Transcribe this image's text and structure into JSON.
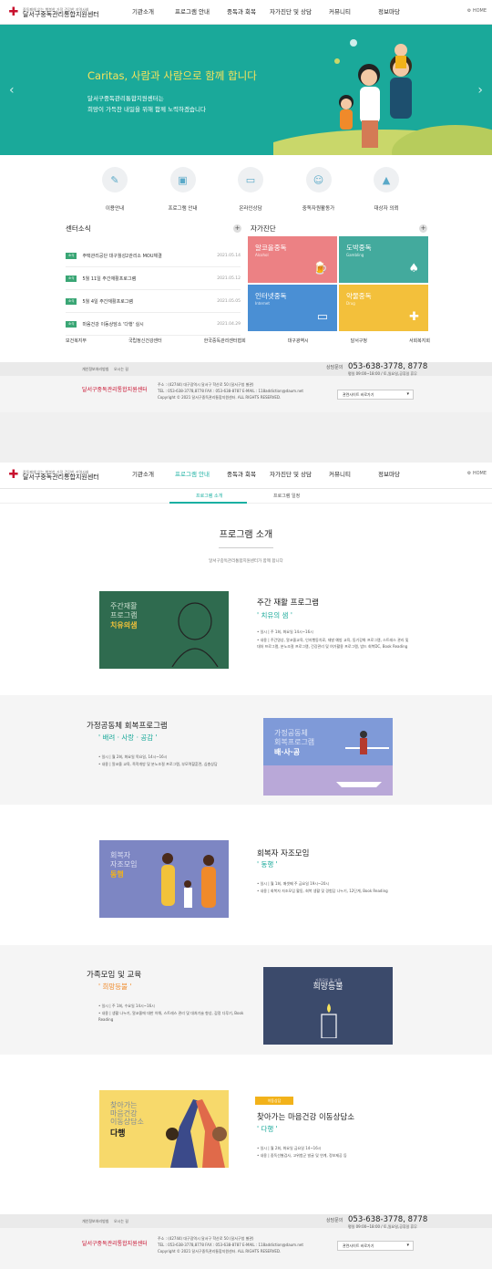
{
  "logo": {
    "name": "달서구중독관리통합지원센터",
    "tagline": "중독폐해 없는 행복한 가정 건강한 지역사회",
    "mark_caption": "Caritas"
  },
  "nav": [
    "기관소개",
    "프로그램 안내",
    "중독과 회복",
    "자가진단 및 상담",
    "커뮤니티",
    "정보마당"
  ],
  "home_label": "HOME",
  "hero": {
    "title": "Caritas, 사람과 사람으로 함께 합니다",
    "line1": "달서구중독관리통합지원센터는",
    "line2": "희망이 가득찬 내일을 위해 함께 노력하겠습니다"
  },
  "quick": [
    {
      "label": "이용안내",
      "icon": "document-pen-icon"
    },
    {
      "label": "프로그램 안내",
      "icon": "chat-icon"
    },
    {
      "label": "온라인상담",
      "icon": "monitor-icon"
    },
    {
      "label": "중독자원활동가",
      "icon": "user-icon"
    },
    {
      "label": "대상자 의뢰",
      "icon": "alarm-icon"
    }
  ],
  "news": {
    "title": "센터소식",
    "badge": "소식",
    "items": [
      {
        "text": "주택관리공단 대구월성2관리소 MOU체결",
        "date": "2021.05.14"
      },
      {
        "text": "5월 11일 주간재활프로그램",
        "date": "2021.05.12"
      },
      {
        "text": "5월 4일 주간재활프로그램",
        "date": "2021.05.05"
      },
      {
        "text": "마음건강 이동상담소 '다행' 실시",
        "date": "2021.04.29"
      }
    ]
  },
  "selfcheck": {
    "title": "자가진단",
    "tiles": [
      {
        "ko": "알코올중독",
        "en": "Alcohol",
        "color": "#ec8184"
      },
      {
        "ko": "도박중독",
        "en": "Gambling",
        "color": "#43aa9d"
      },
      {
        "ko": "인터넷중독",
        "en": "Internet",
        "color": "#4a8fd4"
      },
      {
        "ko": "약물중독",
        "en": "Drug",
        "color": "#f3c03b"
      }
    ]
  },
  "partners": [
    "보건복지부",
    "국립정신건강센터",
    "한국중독관리센터협회",
    "대구광역시",
    "달서구청",
    "서회복지회"
  ],
  "footer": {
    "links": [
      "개인정보처리방침",
      "오시는 길"
    ],
    "address": "주소 : (42744) 대구광역시 달서구 학산로 50 (달서구청 별관)",
    "contacts": "TEL : 053-638-3778,8778   FAX : 053-638-8787   E-MAIL : 118addiction@daum.net",
    "copyright": "Copyright © 2021 달서구중독관리통합지원센터. ALL RIGHTS RESERVED.",
    "tel_label": "상담문의",
    "tel": "053-638-3778, 8778",
    "hours": "평일 09:00~18:00 / 토,일요일,공휴일 휴무",
    "related": "관련사이트 바로가기"
  },
  "program_page": {
    "subtabs": [
      "프로그램 소개",
      "프로그램 일정"
    ],
    "title": "프로그램 소개",
    "subtitle": "달서구중독관리통합지원센터가 함께 합니다",
    "programs": [
      {
        "title": "주간 재활 프로그램",
        "slogan": "' 치유의 샘 '",
        "img_text": [
          "주간재활",
          "프로그램"
        ],
        "img_slogan": "치유의샘",
        "details": [
          "• 일시 | 주 1회, 화요일 14시~16시",
          "• 내용 | 주간명상, 알코올교육, 인지행동치료, 재발 예방 교육, 동기강화 프로그램, 스트레스 관리 및 대처 프로그램, 분노조절 프로그램, 건강관리 및 여가활용 프로그램, 밥드 회복DC, Book Reading"
        ]
      },
      {
        "title": "가정공동체 회복프로그램",
        "slogan": "' 배려 · 사랑 · 공감 '",
        "img_text": [
          "가정공동체",
          "회복프로그램"
        ],
        "img_slogan": "배·사·공",
        "details": [
          "• 일시 | 월 2회, 화요일 목요일, 14시~16시",
          "• 내용 | 알코올 교육, 족적개방 및 분노조절 프로그램, 부모역할훈련, 심층상담"
        ]
      },
      {
        "title": "회복자 자조모임",
        "slogan": "' 동행 '",
        "img_text": [
          "회복자",
          "자조모임"
        ],
        "img_slogan": "동행",
        "details": [
          "• 일시 | 월 1회, 매셋째 주 금요일 19시~20시",
          "• 내용 | 회복자 자조모임 활동, 회복 생활 및 경험담 나누기, 12단계, Book Reading"
        ]
      },
      {
        "title": "가족모임 및 교육",
        "slogan": "' 희망등불 '",
        "img_text": [
          "가족모임 및 교육"
        ],
        "img_slogan": "희망등불",
        "details": [
          "• 일시 | 주 1회, 수요일 14시~16시",
          "• 내용 | 생활 나누기, 알코올에 대한 이해, 스트레스 관리 및 대처기술 향상, 감정 다루기, Book Reading"
        ]
      },
      {
        "title": "찾아가는 마음건강 이동상담소",
        "slogan": "' 다행 '",
        "badge": "이동상담",
        "img_text": [
          "찾아가는",
          "마음건강",
          "이동상담소"
        ],
        "img_slogan": "다행",
        "details": [
          "• 일시 | 월 2회, 화요일 금요일 14~16시",
          "• 내용 | 중독선별검사, 고위험군 발굴 및 연계, 정보제공 등"
        ]
      }
    ]
  }
}
